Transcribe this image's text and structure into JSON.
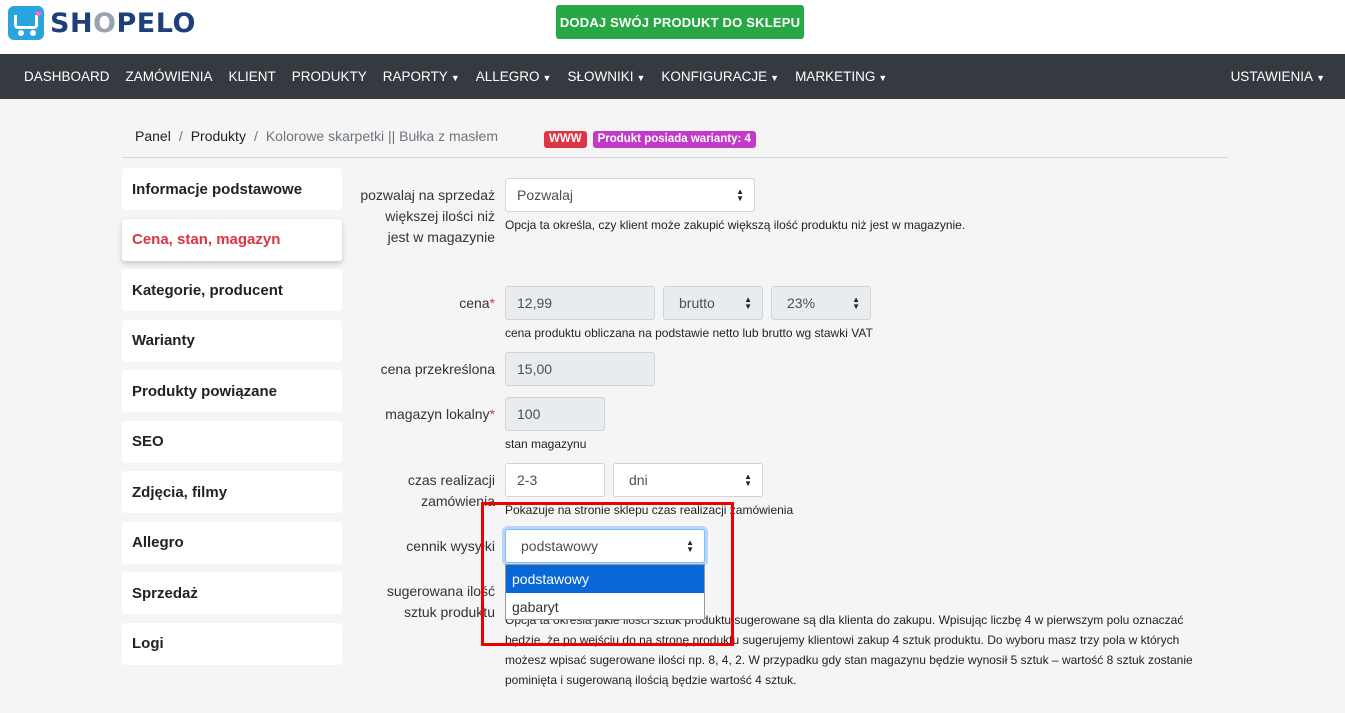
{
  "header": {
    "logo_text_a": "SH",
    "logo_text_o": "O",
    "logo_text_b": "PELO",
    "add_product_button": "DODAJ SWÓJ PRODUKT DO SKLEPU"
  },
  "nav": {
    "items": [
      {
        "label": "DASHBOARD",
        "dropdown": false
      },
      {
        "label": "ZAMÓWIENIA",
        "dropdown": false
      },
      {
        "label": "KLIENT",
        "dropdown": false
      },
      {
        "label": "PRODUKTY",
        "dropdown": false
      },
      {
        "label": "RAPORTY",
        "dropdown": true
      },
      {
        "label": "ALLEGRO",
        "dropdown": true
      },
      {
        "label": "SŁOWNIKI",
        "dropdown": true
      },
      {
        "label": "KONFIGURACJE",
        "dropdown": true
      },
      {
        "label": "MARKETING",
        "dropdown": true
      }
    ],
    "settings": "USTAWIENIA"
  },
  "breadcrumb": {
    "panel": "Panel",
    "products": "Produkty",
    "current": "Kolorowe skarpetki || Bułka z masłem",
    "badge_www": "WWW",
    "badge_variants": "Produkt posiada warianty: 4"
  },
  "sidebar": {
    "items": [
      {
        "label": "Informacje podstawowe",
        "active": false
      },
      {
        "label": "Cena, stan, magazyn",
        "active": true
      },
      {
        "label": "Kategorie, producent",
        "active": false
      },
      {
        "label": "Warianty",
        "active": false
      },
      {
        "label": "Produkty powiązane",
        "active": false
      },
      {
        "label": "SEO",
        "active": false
      },
      {
        "label": "Zdjęcia, filmy",
        "active": false
      },
      {
        "label": "Allegro",
        "active": false
      },
      {
        "label": "Sprzedaż",
        "active": false
      },
      {
        "label": "Logi",
        "active": false
      }
    ]
  },
  "form": {
    "allow_oversell": {
      "label": "pozwalaj na sprzedaż większej ilości niż jest w magazynie",
      "value": "Pozwalaj",
      "help": "Opcja ta określa, czy klient może zakupić większą ilość produktu niż jest w magazynie."
    },
    "price": {
      "label": "cena",
      "required": "*",
      "value": "12,99",
      "type_value": "brutto",
      "vat_value": "23%",
      "help": "cena produktu obliczana na podstawie netto lub brutto wg stawki VAT"
    },
    "strikethrough_price": {
      "label": "cena przekreślona",
      "value": "15,00"
    },
    "local_stock": {
      "label": "magazyn lokalny",
      "required": "*",
      "value": "100",
      "help": "stan magazynu"
    },
    "lead_time": {
      "label": "czas realizacji zamówienia",
      "value": "2-3",
      "unit_value": "dni",
      "help": "Pokazuje na stronie sklepu czas realizacji zamówienia"
    },
    "shipping_pricelist": {
      "label": "cennik wysyłki",
      "value": "podstawowy",
      "options": [
        "podstawowy",
        "gabaryt"
      ]
    },
    "suggested_qty": {
      "label": "sugerowana ilość sztuk produktu",
      "help": "Opcja ta określa jakie ilości sztuk produktu sugerowane są dla klienta do zakupu. Wpisując liczbę 4 w pierwszym polu oznaczać będzie, że po wejściu do na stronę produktu sugerujemy klientowi zakup 4 sztuk produktu. Do wyboru masz trzy pola w których możesz wpisać sugerowane ilości np. 8, 4, 2. W przypadku gdy stan magazynu będzie wynosił 5 sztuk – wartość 8 sztuk zostanie pominięta i sugerowaną ilością będzie wartość 4 sztuk."
    }
  },
  "colors": {
    "navbar": "#343a40",
    "accent_green": "#28a745",
    "active_red": "#dc3545",
    "variant_badge": "#c23ac8",
    "highlight_box": "#ee0000",
    "selected_option": "#0a68d6"
  }
}
